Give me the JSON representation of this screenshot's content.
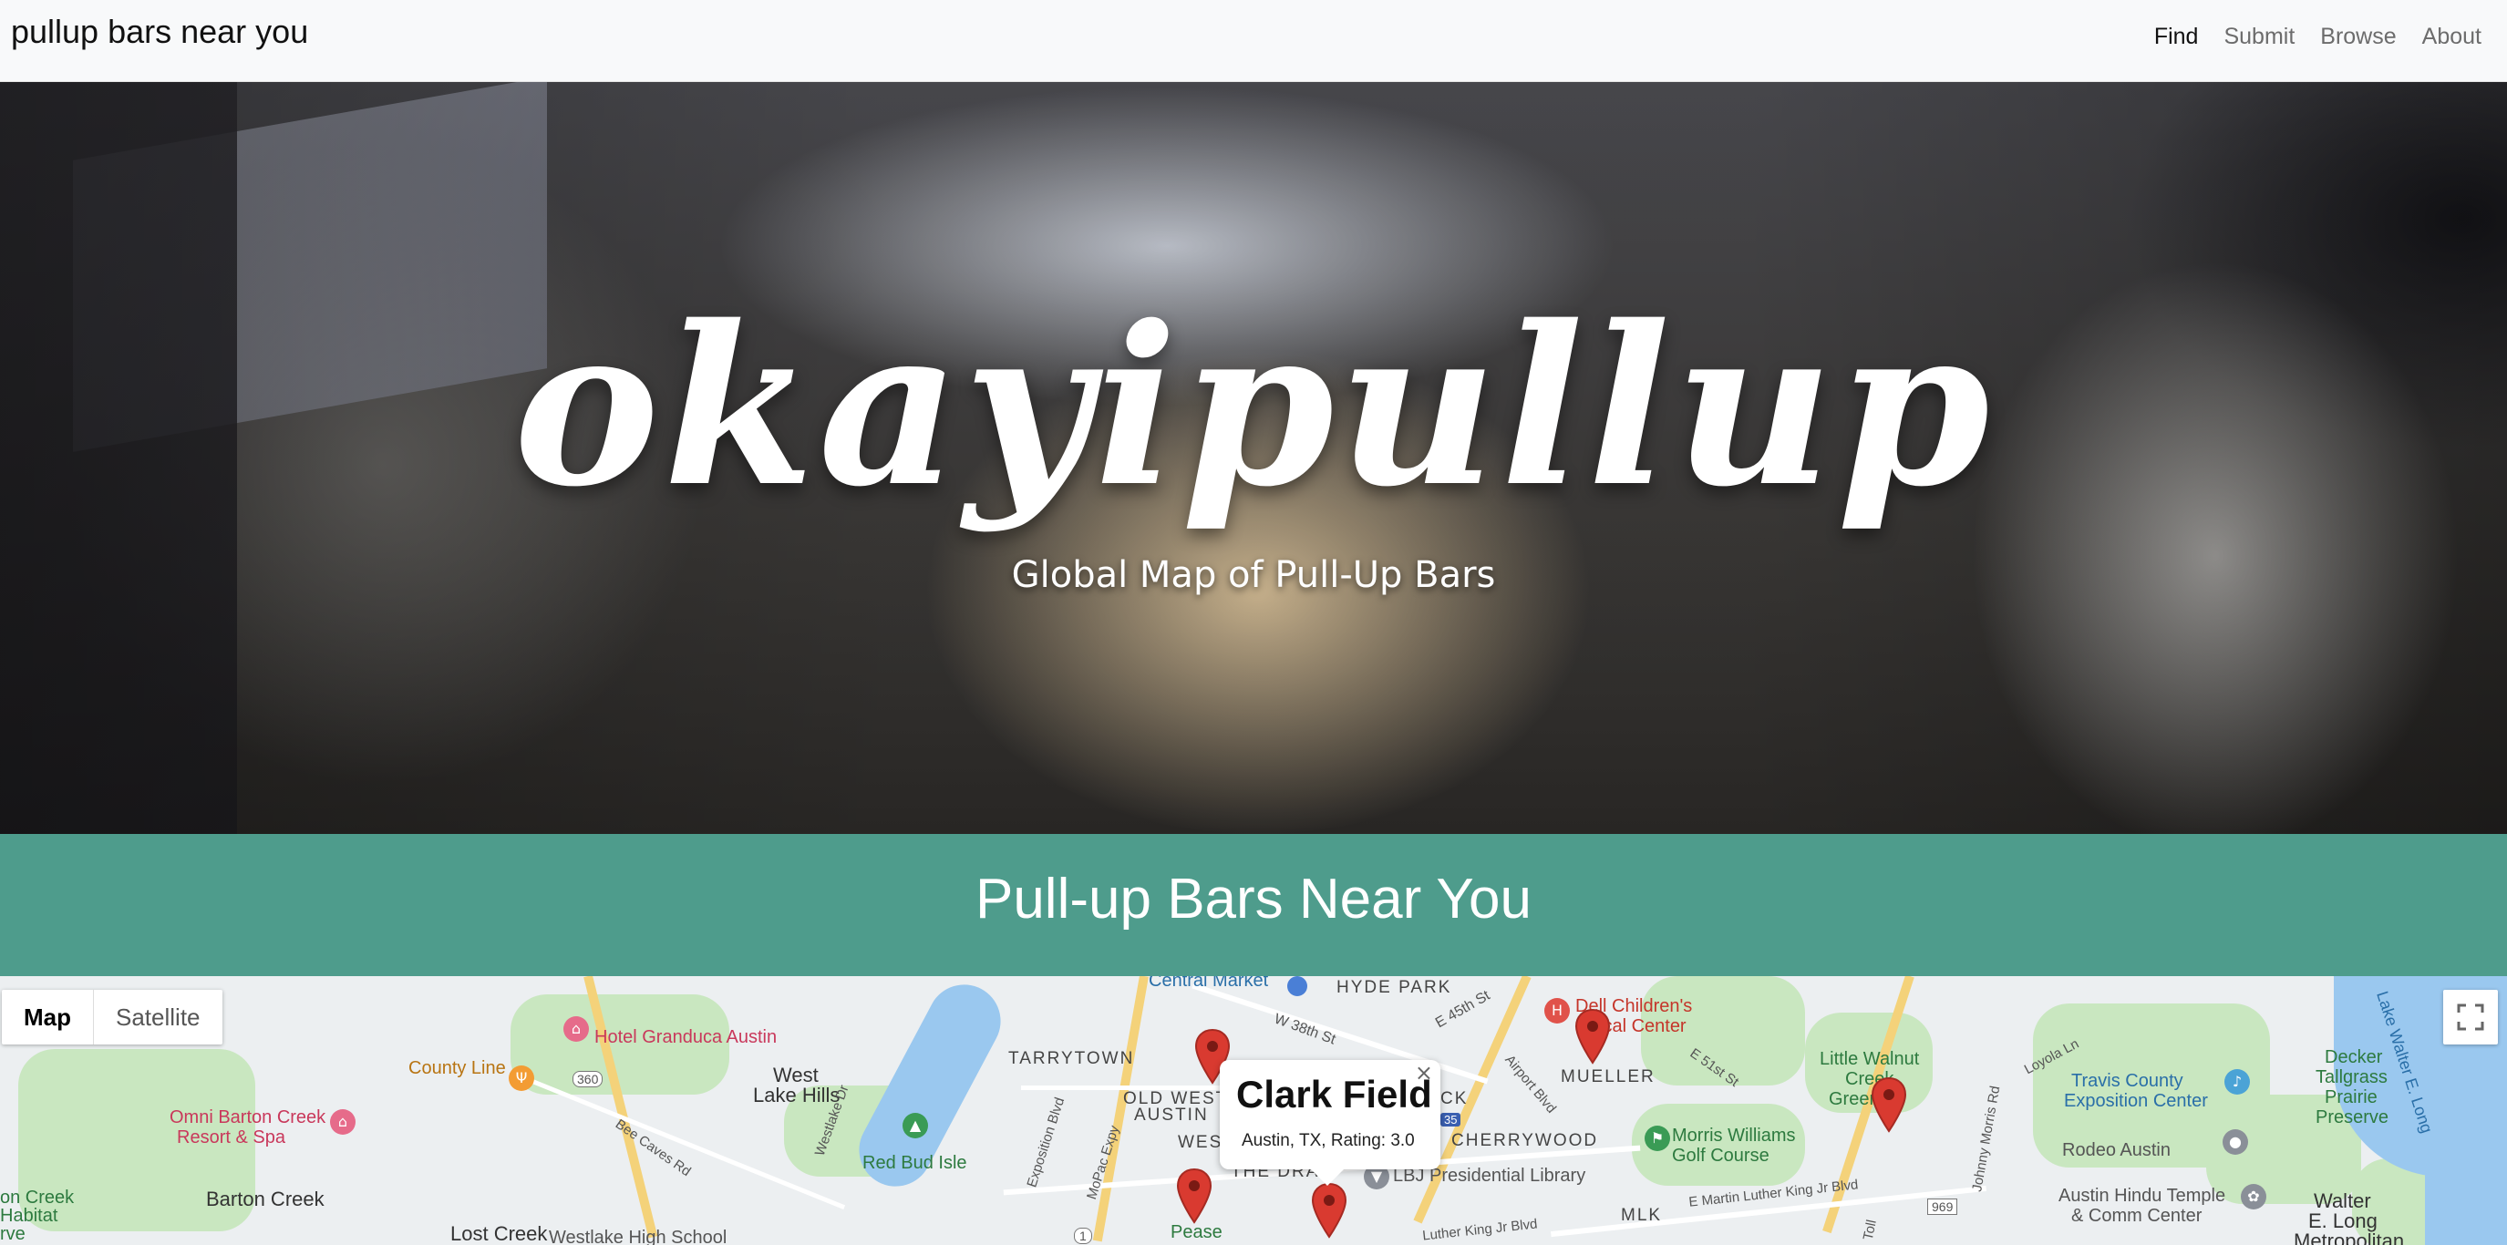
{
  "navbar": {
    "brand": "pullup bars near you",
    "links": [
      {
        "label": "Find",
        "active": true
      },
      {
        "label": "Submit",
        "active": false
      },
      {
        "label": "Browse",
        "active": false
      },
      {
        "label": "About",
        "active": false
      }
    ]
  },
  "hero": {
    "title": "okayipullup",
    "subtitle": "Global Map of Pull-Up Bars"
  },
  "section": {
    "title": "Pull-up Bars Near You",
    "band_color": "#4e9c8c"
  },
  "map": {
    "type_buttons": {
      "map": "Map",
      "satellite": "Satellite"
    },
    "active_type": "Map",
    "fullscreen_icon": "fullscreen-icon",
    "marker_color": "#d93a30",
    "infowindow": {
      "title": "Clark Field",
      "details": "Austin, TX, Rating: 3.0",
      "close_glyph": "×"
    },
    "labels": {
      "central_market": "Central Market",
      "hyde_park": "HYDE PARK",
      "e45": "E 45th St",
      "w38": "W 38th St",
      "hotel": "Hotel Granduca Austin",
      "county_line": "County Line",
      "west_lake_hills_1": "West",
      "west_lake_hills_2": "Lake Hills",
      "tarrytown": "TARRYTOWN",
      "old_west_austin_1": "OLD WEST",
      "old_west_austin_2": "AUSTIN",
      "omni_1": "Omni Barton Creek",
      "omni_2": "Resort & Spa",
      "red_bud": "Red Bud Isle",
      "barton_creek": "Barton Creek",
      "creek_habitat_1": "on Creek",
      "creek_habitat_2": "Habitat",
      "creek_habitat_3": "rve",
      "lost_creek": "Lost Creek",
      "westlake_hs": "Westlake High School",
      "bee_caves": "Bee Caves Rd",
      "westlake_dr": "Westlake Dr",
      "exposition": "Exposition Blvd",
      "mopac": "MoPac Expy",
      "pease": "Pease",
      "the_drag": "THE DRAG",
      "lbj": "LBJ Presidential Library",
      "cherrywood": "CHERRYWOOD",
      "west": "WEST",
      "ck": "CK",
      "dell_1": "Dell Children's",
      "dell_2": "ical Center",
      "mueller": "MUELLER",
      "e51": "E 51st St",
      "airport": "Airport Blvd",
      "morris_1": "Morris Williams",
      "morris_2": "Golf Course",
      "mlk_blvd": "E Martin Luther King Jr Blvd",
      "mlk": "MLK",
      "mlk_jr": "Luther King Jr Blvd",
      "little_walnut_1": "Little Walnut",
      "little_walnut_2": "Creek",
      "little_walnut_3": "Green",
      "loyola": "Loyola Ln",
      "travis_1": "Travis County",
      "travis_2": "Exposition Center",
      "decker_1": "Decker",
      "decker_2": "Tallgrass",
      "decker_3": "Prairie",
      "decker_4": "Preserve",
      "lake_walter": "Lake Walter E. Long",
      "rodeo": "Rodeo Austin",
      "hindu_1": "Austin Hindu Temple",
      "hindu_2": "& Comm Center",
      "walter_1": "Walter",
      "walter_2": "E. Long",
      "walter_3": "Metropolitan",
      "toll": "Toll",
      "morris_rd": "Johnny Morris Rd",
      "shield_360": "360",
      "shield_35": "35",
      "shield_969": "969",
      "shield_1": "1"
    }
  }
}
